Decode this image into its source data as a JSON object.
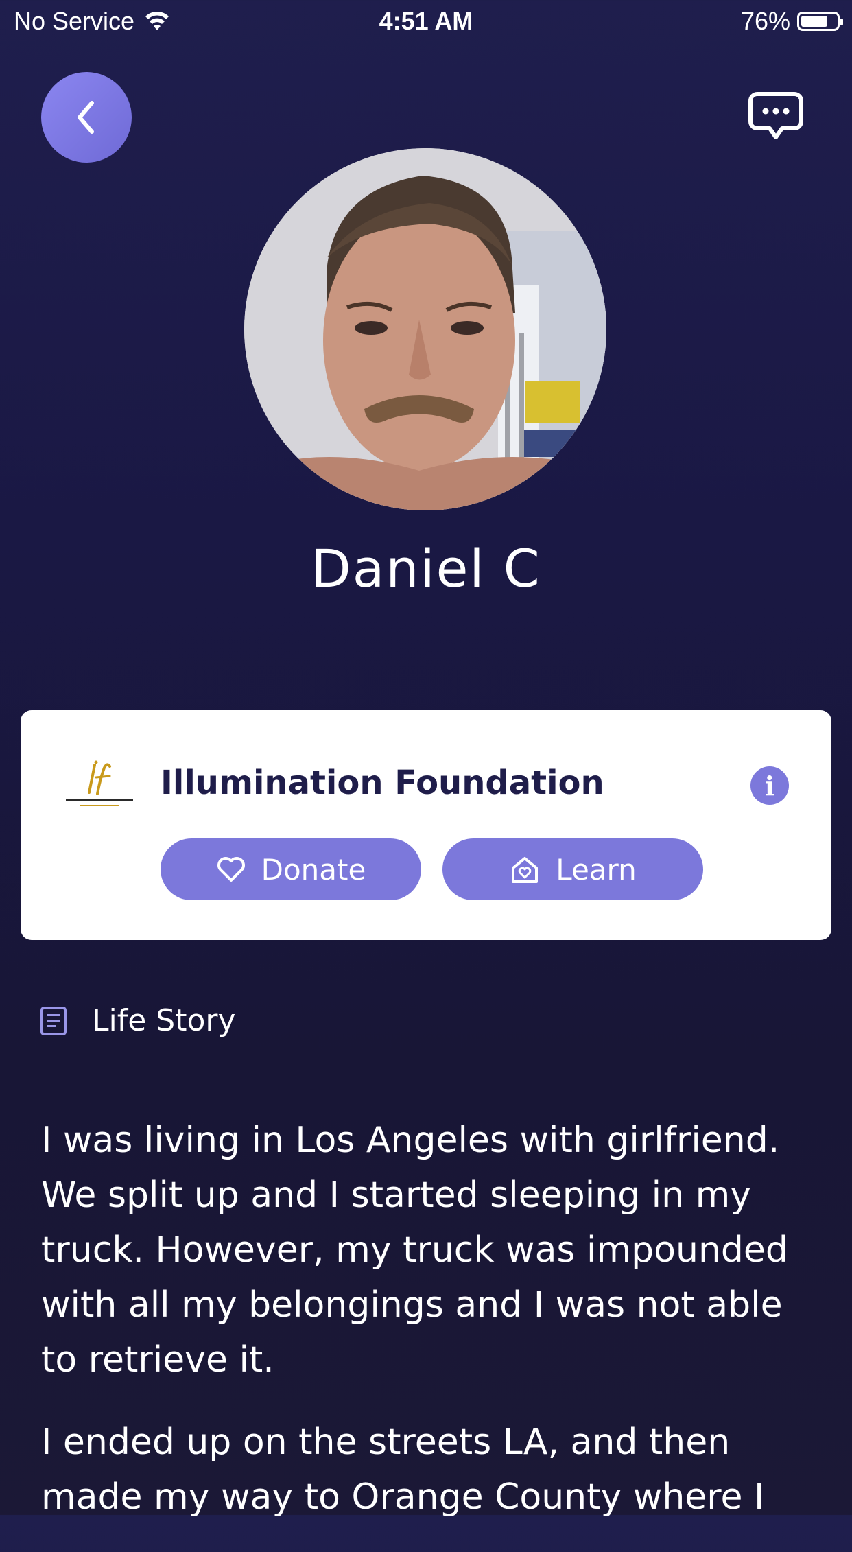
{
  "status_bar": {
    "carrier": "No Service",
    "time": "4:51 AM",
    "battery_percent": "76%",
    "battery_level": 0.76
  },
  "nav": {
    "back_icon": "chevron-left-icon",
    "chat_icon": "chat-bubble-icon"
  },
  "profile": {
    "name": "Daniel C"
  },
  "organization": {
    "logo_text": "ILLUMINATION FOUNDATION",
    "name": "Illumination Foundation",
    "info_label": "i",
    "donate_label": "Donate",
    "learn_label": "Learn"
  },
  "life_story": {
    "title": "Life Story",
    "paragraphs": [
      "I was living in Los Angeles with girlfriend. We split up and I started sleeping in my truck. However, my truck was impounded with all my belongings and I was not able to retrieve it.",
      "I ended up on the streets LA, and then made my way to Orange County where I"
    ]
  },
  "colors": {
    "accent": "#7c78db",
    "background_top": "#1f1e4d",
    "card": "#ffffff",
    "org_name": "#1f1d4a"
  }
}
